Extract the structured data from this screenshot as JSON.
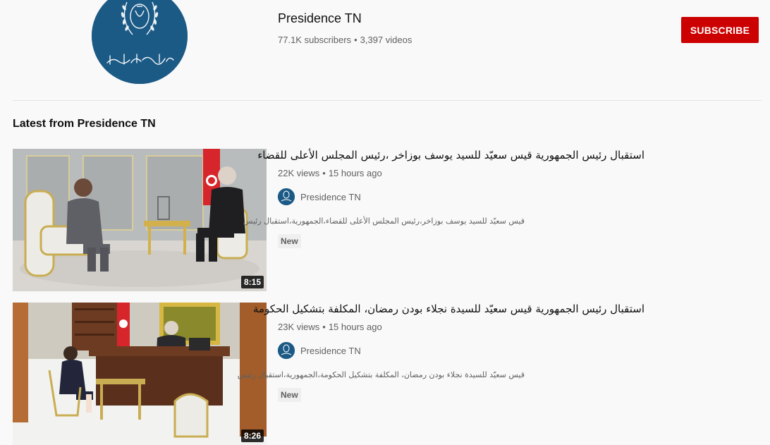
{
  "channel": {
    "name": "Presidence TN",
    "subscribers": "77.1K subscribers",
    "separator": "•",
    "videos_count": "3,397 videos",
    "subscribe_label": "SUBSCRIBE",
    "avatar_icon": "presidency-emblem-icon",
    "brand_color": "#1c5a86"
  },
  "section": {
    "title": "Latest from Presidence TN"
  },
  "videos": [
    {
      "title": "استقبال رئيس الجمهورية قيس سعيّد للسيد يوسف بوزاخر ،رئيس المجلس الأعلى للقضاء",
      "views": "22K views",
      "separator": "•",
      "age": "15 hours ago",
      "channel": "Presidence TN",
      "description": "قيس سعيّد للسيد يوسف بوزاخر،رئيس المجلس الأعلى للقضاء،الجمهورية،استقبال رئيس",
      "badge": "New",
      "duration": "8:15"
    },
    {
      "title": "استقبال رئيس الجمهورية قيس سعيّد للسيدة نجلاء بودن رمضان، المكلفة بتشكيل الحكومة",
      "views": "23K views",
      "separator": "•",
      "age": "15 hours ago",
      "channel": "Presidence TN",
      "description": "قيس سعيّد للسيدة نجلاء بودن رمضان، المكلفة بتشكيل الحكومة،الجمهورية،استقبال رئيس",
      "badge": "New",
      "duration": "8:26"
    }
  ],
  "colors": {
    "subscribe": "#cc0000",
    "background": "#f9f9f9",
    "secondary_text": "#606060"
  }
}
